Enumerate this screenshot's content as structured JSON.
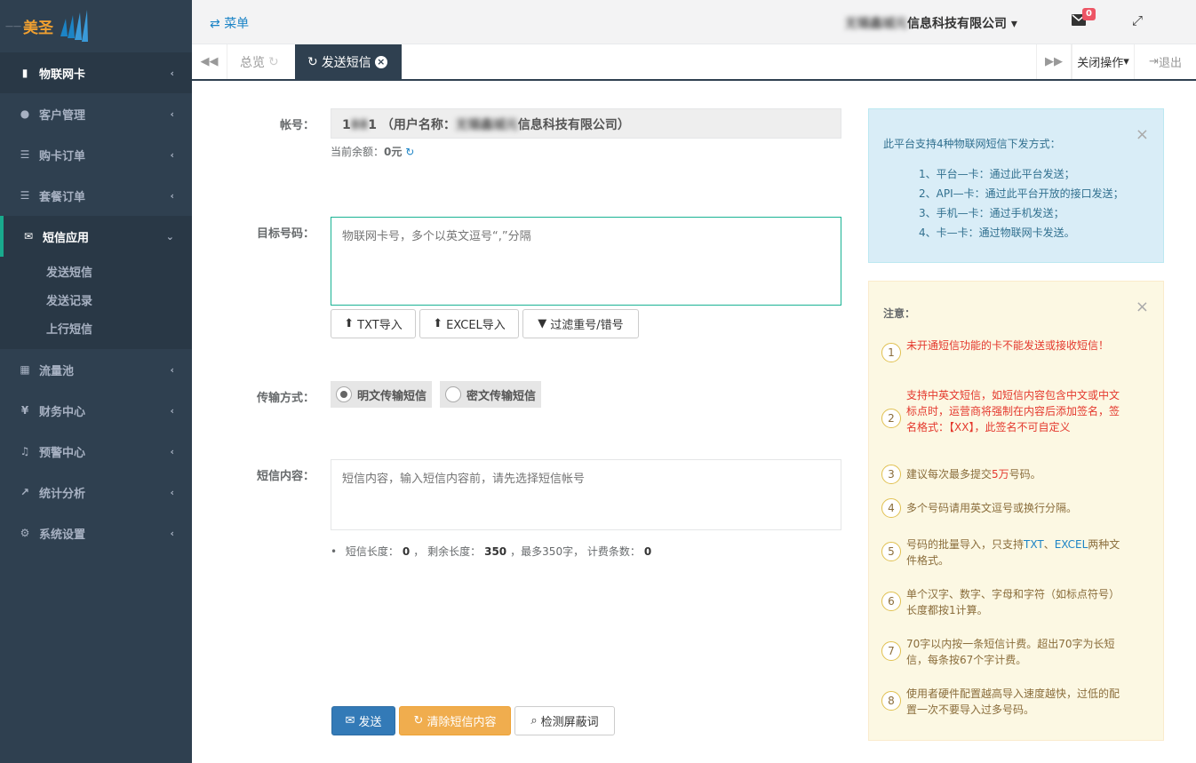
{
  "sidebar": {
    "logo_text": "美圣",
    "items": [
      {
        "label": "物联网卡",
        "icon": "sim-card-icon"
      },
      {
        "label": "客户管理",
        "icon": "user-circle-icon"
      },
      {
        "label": "购卡订单",
        "icon": "list-icon"
      },
      {
        "label": "套餐订单",
        "icon": "list-icon"
      },
      {
        "label": "短信应用",
        "icon": "envelope-icon"
      },
      {
        "label": "流量池",
        "icon": "grid-icon"
      },
      {
        "label": "财务中心",
        "icon": "yen-icon"
      },
      {
        "label": "预警中心",
        "icon": "bell-icon"
      },
      {
        "label": "统计分析",
        "icon": "line-chart-icon"
      },
      {
        "label": "系统设置",
        "icon": "gear-icon"
      }
    ],
    "sub_items": [
      "发送短信",
      "发送记录",
      "上行短信"
    ]
  },
  "topbar": {
    "menu_label": "菜单",
    "company_blur": "无锡鑫城元",
    "company_suffix": "信息科技有限公司",
    "mail_count": "0"
  },
  "tabs": {
    "home": "总览",
    "active": "发送短信",
    "close_ops": "关闭操作",
    "logout": "退出"
  },
  "form": {
    "account_label": "帐号：",
    "account_id": "1",
    "account_id_tail": "1",
    "account_username_label": "（用户名称：",
    "account_company_blur": "无锡鑫城元",
    "account_company_tail": "信息科技有限公司）",
    "balance_label": "当前余额：",
    "balance_value": "0元",
    "target_label": "目标号码：",
    "target_placeholder": "物联网卡号，多个以英文逗号“,”分隔",
    "txt_import": "TXT导入",
    "excel_import": "EXCEL导入",
    "filter": "过滤重号/错号",
    "transfer_label": "传输方式：",
    "plain": "明文传输短信",
    "cipher": "密文传输短信",
    "content_label": "短信内容：",
    "content_placeholder": "短信内容，输入短信内容前，请先选择短信帐号",
    "stats_len_label": "短信长度：",
    "stats_len": "0",
    "stats_remain_label": "， 剩余长度：",
    "stats_remain": "350",
    "stats_max": "，最多350字， 计费条数：",
    "stats_count": "0",
    "send": "发送",
    "clear": "清除短信内容",
    "check": "检测屏蔽词"
  },
  "info": {
    "title": "此平台支持4种物联网短信下发方式：",
    "lines": [
      "1、平台—卡：通过此平台发送；",
      "2、API—卡：通过此平台开放的接口发送；",
      "3、手机—卡：通过手机发送；",
      "4、卡—卡：通过物联网卡发送。"
    ]
  },
  "warn": {
    "title": "注意：",
    "n1": "未开通短信功能的卡不能发送或接收短信！",
    "n2": "支持中英文短信，如短信内容包含中文或中文标点时，运营商将强制在内容后添加签名，签名格式：【XX】，此签名不可自定义",
    "n3a": "建议每次最多提交",
    "n3b": "5万",
    "n3c": "号码。",
    "n4": "多个号码请用英文逗号或换行分隔。",
    "n5a": "号码的批量导入，只支持",
    "n5b": "TXT",
    "n5c": "、",
    "n5d": "EXCEL",
    "n5e": "两种文件格式。",
    "n6": "单个汉字、数字、字母和字符（如标点符号）长度都按1计算。",
    "n7": "70字以内按一条短信计费。超出70字为长短信，每条按67个字计费。",
    "n8": "使用者硬件配置越高导入速度越快，过低的配置一次不要导入过多号码。"
  }
}
